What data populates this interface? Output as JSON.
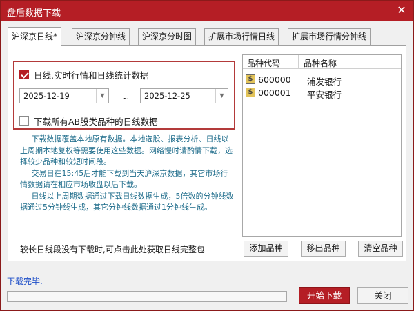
{
  "window": {
    "title": "盘后数据下载",
    "close_glyph": "✕"
  },
  "tabs": [
    {
      "label": "沪深京日线*",
      "active": true
    },
    {
      "label": "沪深京分钟线"
    },
    {
      "label": "沪深京分时图"
    },
    {
      "label": "扩展市场行情日线"
    },
    {
      "label": "扩展市场行情分钟线"
    }
  ],
  "daily": {
    "option_main": {
      "label": "日线,实时行情和日线统计数据",
      "checked": true
    },
    "start_date": "2025-12-19",
    "end_date": "2025-12-25",
    "range_separator": "~",
    "option_all_ab": {
      "label": "下载所有AB股类品种的日线数据",
      "checked": false
    },
    "description": [
      "下载数据覆盖本地原有数据。本地选股、报表分析、日线以上周期本地复权等需要使用这些数据。网络慢时请酌情下载，选择较少品种和较短时间段。",
      "交易日在15:45后才能下载到当天沪深京数据，其它市场行情数据请在相应市场收盘以后下载。",
      "日线以上周期数据通过下载日线数据生成，5倍数的分钟线数据通过5分钟线生成，其它分钟线数据通过1分钟线生成。"
    ],
    "full_data_link": "较长日线段没有下载时,可点击此处获取日线完整包"
  },
  "stock_list": {
    "columns": [
      "品种代码",
      "品种名称"
    ],
    "rows": [
      {
        "code": "600000",
        "name": "浦发银行"
      },
      {
        "code": "000001",
        "name": "平安银行"
      }
    ],
    "row_icon": "stock-icon",
    "buttons": {
      "add": "添加品种",
      "remove": "移出品种",
      "clear": "清空品种"
    }
  },
  "footer": {
    "status": "下载完毕.",
    "progress": 0,
    "start_button": "开始下载",
    "close_button": "关闭"
  },
  "colors": {
    "accent": "#b51e25",
    "group_border": "#b33a3a",
    "description_text": "#1c6b8a",
    "status_text": "#1f4fc8"
  }
}
